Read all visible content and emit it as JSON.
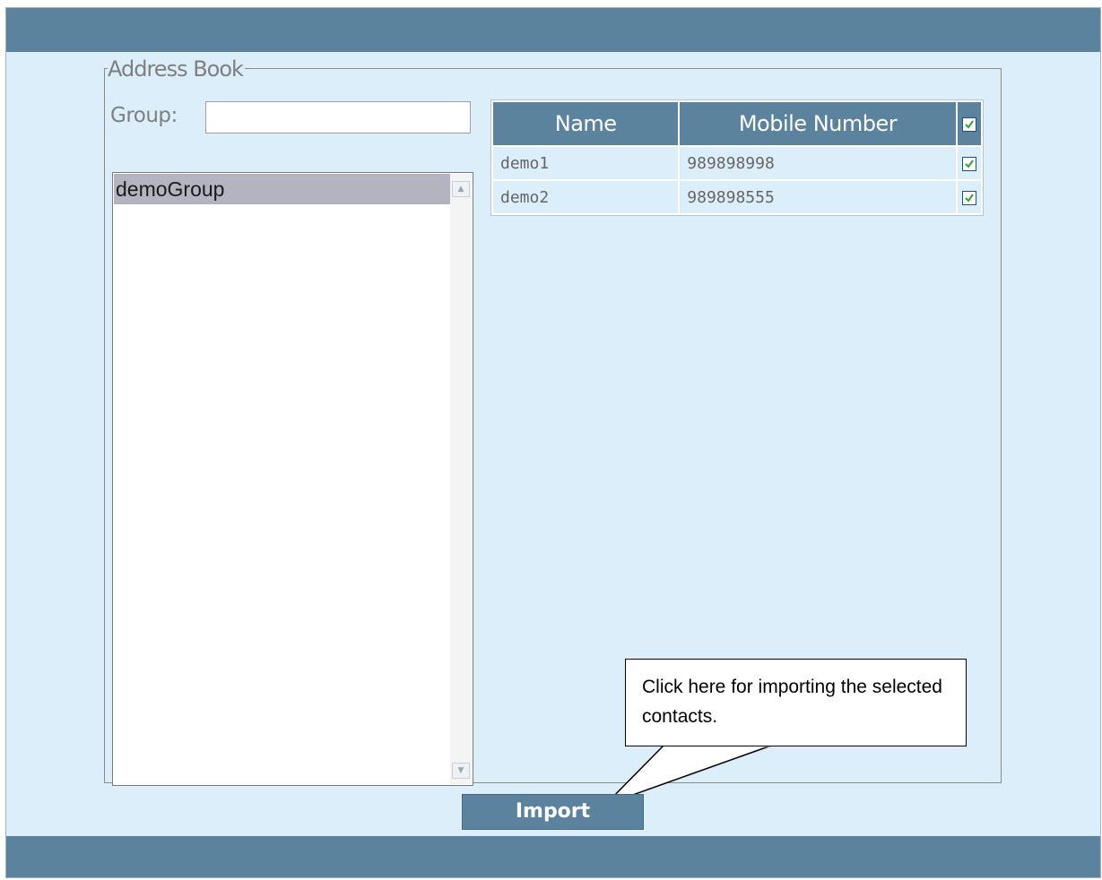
{
  "address_book": {
    "legend": "Address Book",
    "group_label": "Group:",
    "group_input_value": "",
    "groups": [
      {
        "label": "demoGroup",
        "selected": true
      }
    ]
  },
  "contacts_table": {
    "headers": [
      "Name",
      "Mobile Number"
    ],
    "header_checked": true,
    "rows": [
      {
        "name": "demo1",
        "mobile": "989898998",
        "checked": true
      },
      {
        "name": "demo2",
        "mobile": "989898555",
        "checked": true
      }
    ]
  },
  "callout": {
    "text": "Click here for importing the selected contacts."
  },
  "actions": {
    "import_label": "Import"
  },
  "colors": {
    "bar": "#5b839e",
    "panel_bg": "#ddeefb",
    "checkmark": "#2ea12e"
  },
  "icons": {
    "scroll_up": "chevron-up-icon",
    "scroll_down": "chevron-down-icon",
    "check": "checkmark-icon"
  }
}
